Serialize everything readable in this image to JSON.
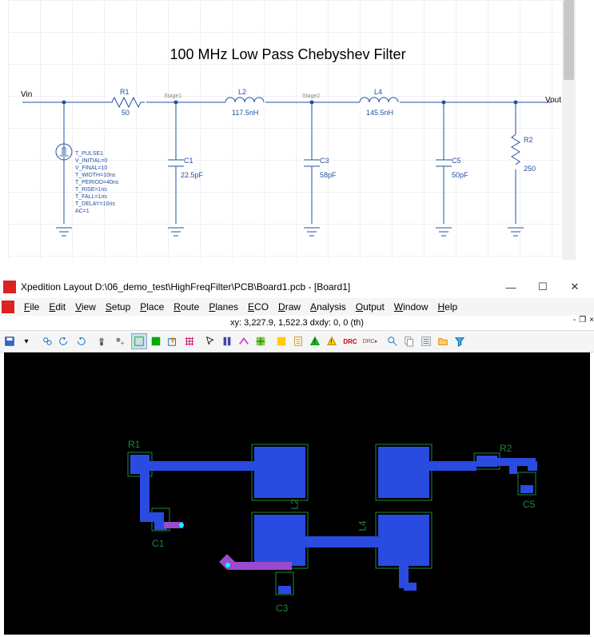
{
  "schematic": {
    "title": "100 MHz Low Pass Chebyshev Filter",
    "vin_label": "Vin",
    "vout_label": "Vout",
    "r1_name": "R1",
    "r1_value": "50",
    "l2_name": "L2",
    "l2_value": "117.5nH",
    "l4_name": "L4",
    "l4_value": "145.5nH",
    "r2_name": "R2",
    "r2_value": "250",
    "c1_name": "C1",
    "c1_value": "22.5pF",
    "c3_name": "C3",
    "c3_value": "58pF",
    "c5_name": "C5",
    "c5_value": "50pF",
    "stage1": "Stage1",
    "stage2": "Stage2",
    "pulse_lines": [
      "T_PULSE1",
      "V_INITIAL=0",
      "V_FINAL=10",
      "T_WIDTH=10ns",
      "T_PERIOD=40ns",
      "T_RISE=1ns",
      "T_FALL=1ns",
      "T_DELAY=10ns",
      "AC=1"
    ]
  },
  "layout": {
    "title": "Xpedition Layout  D:\\06_demo_test\\HighFreqFilter\\PCB\\Board1.pcb - [Board1]",
    "menu": [
      "File",
      "Edit",
      "View",
      "Setup",
      "Place",
      "Route",
      "Planes",
      "ECO",
      "Draw",
      "Analysis",
      "Output",
      "Window",
      "Help"
    ],
    "status": "xy: 3,227.9, 1,522.3  dxdy: 0, 0  (th)",
    "pcb_labels": {
      "r1": "R1",
      "r2": "R2",
      "c1": "C1",
      "c3": "C3",
      "c5": "C5",
      "l2": "L2",
      "l4": "L4"
    }
  }
}
